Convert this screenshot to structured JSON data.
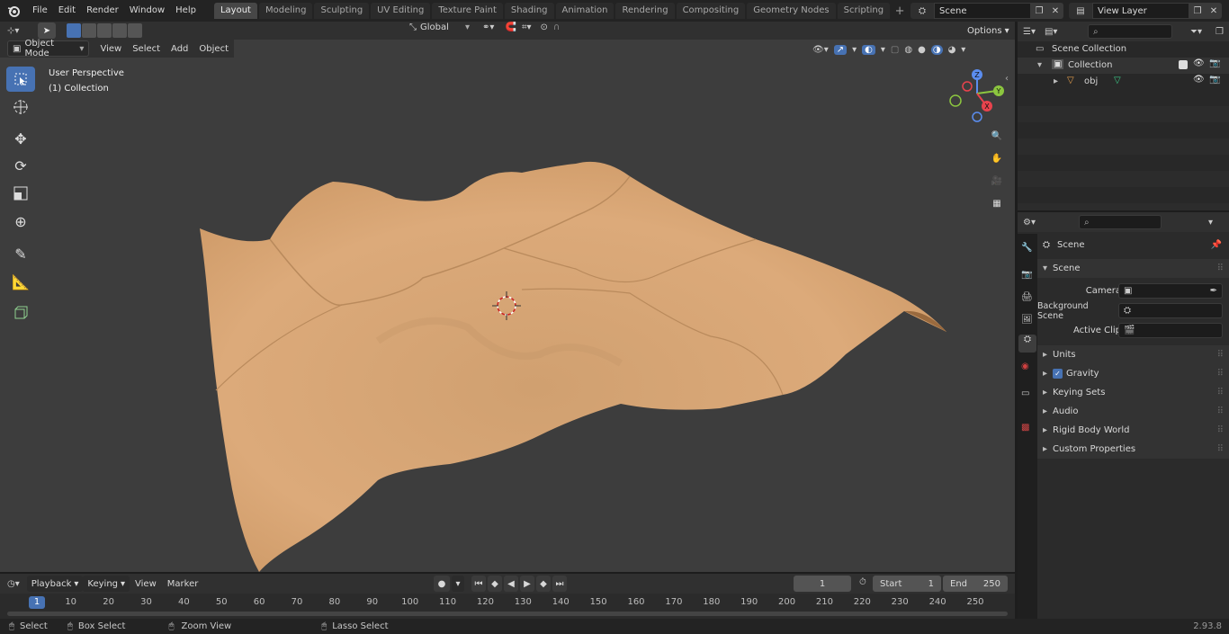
{
  "topbar": {
    "menus": [
      "File",
      "Edit",
      "Render",
      "Window",
      "Help"
    ],
    "workspaces": [
      "Layout",
      "Modeling",
      "Sculpting",
      "UV Editing",
      "Texture Paint",
      "Shading",
      "Animation",
      "Rendering",
      "Compositing",
      "Geometry Nodes",
      "Scripting"
    ],
    "active_workspace": "Layout",
    "scene_name": "Scene",
    "view_layer": "View Layer"
  },
  "viewport_header": {
    "mode": "Object Mode",
    "menus": [
      "View",
      "Select",
      "Add",
      "Object"
    ],
    "orientation": "Global",
    "options": "Options"
  },
  "viewport": {
    "perspective": "User Perspective",
    "collection": "(1) Collection",
    "gizmo": {
      "z": "Z",
      "y": "Y",
      "x": "X"
    }
  },
  "outliner": {
    "root": "Scene Collection",
    "collection": "Collection",
    "object": "obj"
  },
  "properties": {
    "context": "Scene",
    "section": "Scene",
    "fields": [
      {
        "label": "Camera"
      },
      {
        "label": "Background Scene"
      },
      {
        "label": "Active Clip"
      }
    ],
    "panels": [
      "Units",
      "Gravity",
      "Keying Sets",
      "Audio",
      "Rigid Body World",
      "Custom Properties"
    ]
  },
  "timeline": {
    "menus": [
      "Playback",
      "Keying",
      "View",
      "Marker"
    ],
    "current_frame": "1",
    "start_label": "Start",
    "start_value": "1",
    "end_label": "End",
    "end_value": "250",
    "ruler": [
      "1",
      "10",
      "20",
      "30",
      "40",
      "50",
      "60",
      "70",
      "80",
      "90",
      "100",
      "110",
      "120",
      "130",
      "140",
      "150",
      "160",
      "170",
      "180",
      "190",
      "200",
      "210",
      "220",
      "230",
      "240",
      "250"
    ]
  },
  "statusbar": {
    "select": "Select",
    "box_select": "Box Select",
    "zoom_view": "Zoom View",
    "lasso_select": "Lasso Select",
    "version": "2.93.8"
  },
  "colors": {
    "accent": "#4772b3",
    "terrain": "#d9a777",
    "viewport_bg": "#3d3d3d"
  }
}
